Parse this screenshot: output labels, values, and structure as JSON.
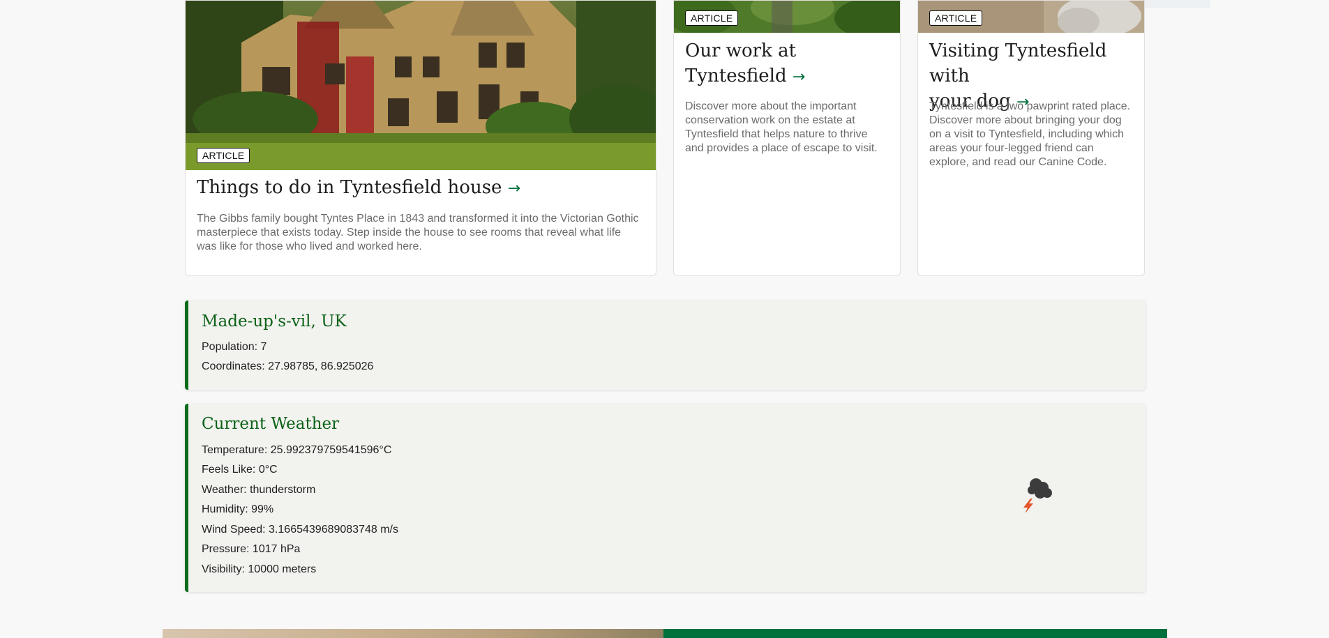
{
  "cards": [
    {
      "badge": "ARTICLE",
      "title": "Things to do in Tyntesfield house",
      "arrow": "→",
      "description": "The Gibbs family bought Tyntes Place in 1843 and transformed it into the Victorian Gothic masterpiece that exists today. Step inside the house to see rooms that reveal what life was like for those who lived and worked here."
    },
    {
      "badge": "ARTICLE",
      "title_line1": "Our work at",
      "title_line2": "Tyntesfield",
      "arrow": "→",
      "description": "Discover more about the important conservation work on the estate at Tyntesfield that helps nature to thrive and provides a place of escape to visit."
    },
    {
      "badge": "ARTICLE",
      "title_line1": "Visiting Tyntesfield with",
      "title_line2": "your dog",
      "arrow": "→",
      "description": "Tyntesfield is a two pawprint rated place. Discover more about bringing your dog on a visit to Tyntesfield, including which areas your four-legged friend can explore, and read our Canine Code."
    }
  ],
  "location": {
    "name": "Made-up's-vil, UK",
    "population": "Population: 7",
    "coordinates": "Coordinates: 27.98785, 86.925026"
  },
  "weather": {
    "heading": "Current Weather",
    "temperature": "Temperature: 25.992379759541596°C",
    "feels_like": "Feels Like: 0°C",
    "condition": "Weather: thunderstorm",
    "humidity": "Humidity: 99%",
    "wind_speed": "Wind Speed: 3.1665439689083748 m/s",
    "pressure": "Pressure: 1017 hPa",
    "visibility": "Visibility: 10000 meters",
    "icon": "thunderstorm-icon"
  },
  "colors": {
    "accent_green": "#00703c",
    "panel_border": "#0a6b1a",
    "heading_green": "#0b6216"
  }
}
